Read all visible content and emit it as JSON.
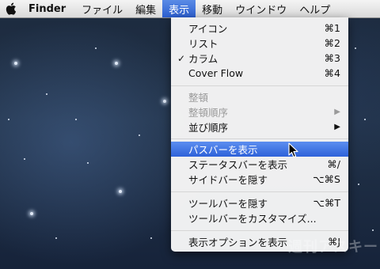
{
  "menubar": {
    "app": "Finder",
    "items": [
      "ファイル",
      "編集",
      "表示",
      "移動",
      "ウインドウ",
      "ヘルプ"
    ],
    "active_index": 2
  },
  "view_menu": {
    "items": [
      {
        "label": "アイコン",
        "shortcut": "⌘1"
      },
      {
        "label": "リスト",
        "shortcut": "⌘2"
      },
      {
        "label": "カラム",
        "shortcut": "⌘3",
        "checked": true
      },
      {
        "label": "Cover Flow",
        "shortcut": "⌘4"
      },
      {
        "label": "整頓",
        "disabled": true
      },
      {
        "label": "整頓順序",
        "disabled": true,
        "submenu": true
      },
      {
        "label": "並び順序",
        "submenu": true
      },
      {
        "label": "パスバーを表示",
        "highlighted": true
      },
      {
        "label": "ステータスバーを表示",
        "shortcut": "⌘/"
      },
      {
        "label": "サイドバーを隠す",
        "shortcut": "⌥⌘S"
      },
      {
        "label": "ツールバーを隠す",
        "shortcut": "⌥⌘T"
      },
      {
        "label": "ツールバーをカスタマイズ..."
      },
      {
        "label": "表示オプションを表示",
        "shortcut": "⌘J"
      }
    ],
    "check_glyph": "✓",
    "submenu_glyph": "▶"
  },
  "watermark": "週刊アスキー",
  "colors": {
    "highlight": "#3a6fe0",
    "menu_bg": "#f6f6f6",
    "desktop": "#1f2f45"
  },
  "icons": {
    "apple": "apple-icon",
    "cursor": "mouse-pointer-icon"
  }
}
